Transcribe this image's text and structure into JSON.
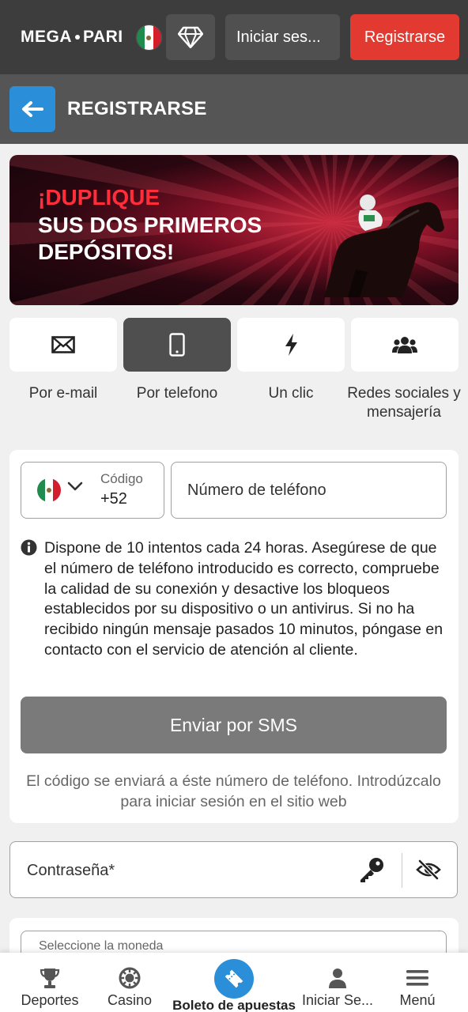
{
  "header": {
    "logo_text_left": "MEGA",
    "logo_text_right": "PARI",
    "login_label": "Iniciar ses...",
    "register_label": "Registrarse"
  },
  "titlebar": {
    "title": "REGISTRARSE"
  },
  "banner": {
    "line1": "¡DUPLIQUE",
    "line2": "SUS DOS PRIMEROS DEPÓSITOS!"
  },
  "methods": [
    {
      "label": "Por e-mail",
      "icon": "envelope-icon",
      "active": false
    },
    {
      "label": "Por telefono",
      "icon": "mobile-phone-icon",
      "active": true
    },
    {
      "label": "Un clic",
      "icon": "lightning-icon",
      "active": false
    },
    {
      "label": "Redes sociales y mensajería",
      "icon": "users-icon",
      "active": false
    }
  ],
  "phone_form": {
    "code_label": "Código",
    "code_value": "+52",
    "phone_placeholder": "Número de teléfono",
    "info": "Dispone de 10 intentos cada 24 horas. Asegúrese de que el número de teléfono introducido es correcto, compruebe la calidad de su conexión y desactive los bloqueos establecidos por su dispositivo o un antivirus. Si no ha recibido ningún mensaje pasados 10 minutos, póngase en contacto con el servicio de atención al cliente.",
    "sms_button": "Enviar por SMS",
    "sms_note": "El código se enviará a éste número de teléfono. Introdúzcalo para iniciar sesión en el sitio web"
  },
  "password": {
    "label": "Contraseña*"
  },
  "currency": {
    "label": "Seleccione la moneda"
  },
  "bottom_nav": {
    "sports": "Deportes",
    "casino": "Casino",
    "betslip": "Boleto de apuestas",
    "login": "Iniciar Se...",
    "menu": "Menú"
  },
  "colors": {
    "topbar": "#3d3d3d",
    "titlebar": "#555555",
    "accent_red": "#e23a30",
    "accent_blue": "#2a8fd8",
    "sms_button": "#7a7a7a"
  }
}
